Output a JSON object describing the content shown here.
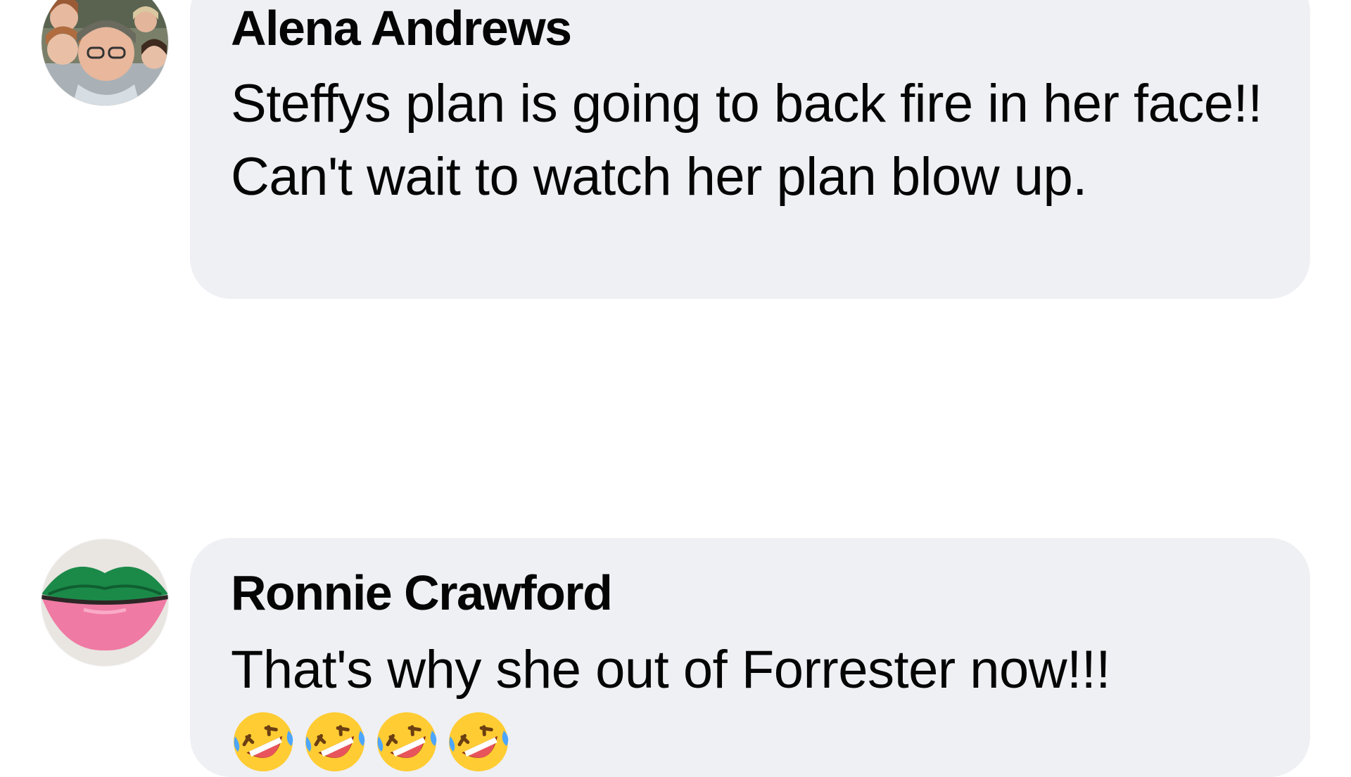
{
  "comments": [
    {
      "author": "Alena Andrews",
      "text": "Steffys plan is going to back fire in her face!! Can't wait to watch her plan blow up.",
      "avatar": "family-photo-avatar"
    },
    {
      "author": "Ronnie Crawford",
      "text": "That's why she out of Forrester now!!!",
      "avatar": "green-pink-lips-avatar",
      "reactions": [
        "rolling-on-floor-laughing-emoji",
        "rolling-on-floor-laughing-emoji",
        "rolling-on-floor-laughing-emoji",
        "rolling-on-floor-laughing-emoji"
      ]
    }
  ],
  "colors": {
    "bubble": "#eff0f4",
    "text": "#050505",
    "background": "#ffffff"
  }
}
